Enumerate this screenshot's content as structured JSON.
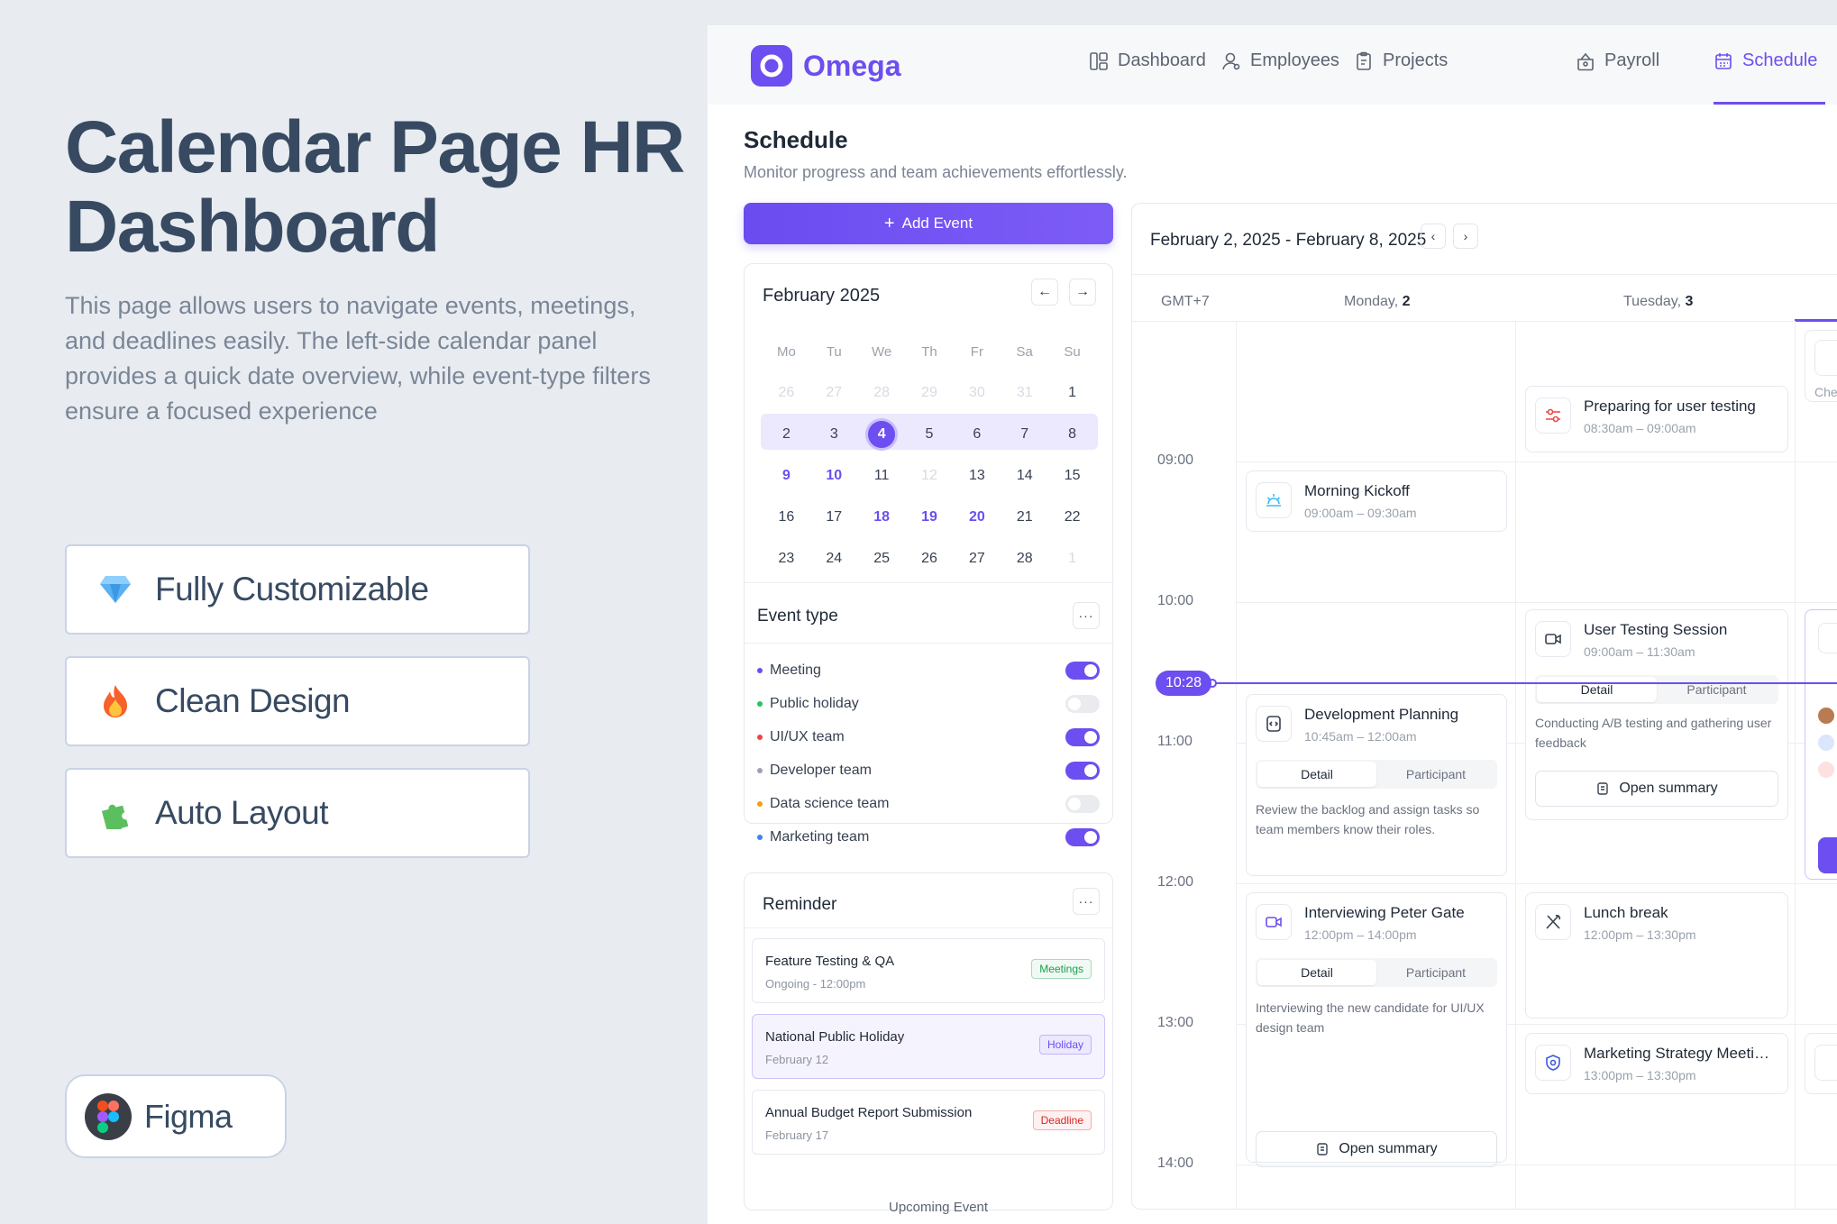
{
  "promo": {
    "title": "Calendar Page HR Dashboard",
    "description": "This page allows users to navigate events, meetings, and deadlines easily. The left-side calendar panel provides a quick date overview, while event-type filters ensure a focused experience",
    "features": [
      {
        "label": "Fully Customizable",
        "icon": "diamond-icon"
      },
      {
        "label": "Clean Design",
        "icon": "fire-icon"
      },
      {
        "label": "Auto Layout",
        "icon": "puzzle-icon"
      }
    ],
    "figma_label": "Figma"
  },
  "app": {
    "brand": "Omega",
    "nav": [
      {
        "label": "Dashboard",
        "icon": "dashboard-icon"
      },
      {
        "label": "Employees",
        "icon": "employees-icon"
      },
      {
        "label": "Projects",
        "icon": "projects-icon"
      },
      {
        "label": "Payroll",
        "icon": "payroll-icon"
      },
      {
        "label": "Schedule",
        "icon": "calendar-icon",
        "active": true
      }
    ],
    "accent": "#6d4ef0"
  },
  "page": {
    "title": "Schedule",
    "subtitle": "Monitor progress and team achievements effortlessly.",
    "add_event": "Add Event"
  },
  "mini_calendar": {
    "month": "February 2025",
    "weekdays": [
      "Mo",
      "Tu",
      "We",
      "Th",
      "Fr",
      "Sa",
      "Su"
    ],
    "weeks": [
      [
        "26",
        "27",
        "28",
        "29",
        "30",
        "31",
        "1"
      ],
      [
        "2",
        "3",
        "4",
        "5",
        "6",
        "7",
        "8"
      ],
      [
        "9",
        "10",
        "11",
        "12",
        "13",
        "14",
        "15"
      ],
      [
        "16",
        "17",
        "18",
        "19",
        "20",
        "21",
        "22"
      ],
      [
        "23",
        "24",
        "25",
        "26",
        "27",
        "28",
        "1"
      ]
    ],
    "today": "4",
    "highlighted": [
      "9",
      "10",
      "18",
      "19",
      "20"
    ]
  },
  "event_types": {
    "title": "Event type",
    "more": "···",
    "items": [
      {
        "label": "Meeting",
        "color": "#6d4ef0",
        "on": true
      },
      {
        "label": "Public holiday",
        "color": "#22c55e",
        "on": false
      },
      {
        "label": "UI/UX team",
        "color": "#ef4444",
        "on": true
      },
      {
        "label": "Developer team",
        "color": "#9ca3af",
        "on": true
      },
      {
        "label": "Data science team",
        "color": "#f59e0b",
        "on": false
      },
      {
        "label": "Marketing team",
        "color": "#3b82f6",
        "on": true
      }
    ]
  },
  "reminder": {
    "title": "Reminder",
    "more": "···",
    "items": [
      {
        "title": "Feature Testing & QA",
        "sub": "Ongoing - 12:00pm",
        "badge": "Meetings",
        "badge_color": "#16a34a"
      },
      {
        "title": "National Public Holiday",
        "sub": "February 12",
        "badge": "Holiday",
        "badge_color": "#6d4ef0"
      },
      {
        "title": "Annual Budget Report Submission",
        "sub": "February 17",
        "badge": "Deadline",
        "badge_color": "#dc2626"
      }
    ],
    "more_link": "Upcoming Event"
  },
  "schedule": {
    "range": "February 2, 2025 - February 8, 2025",
    "timezone": "GMT+7",
    "days": [
      {
        "name": "Monday,",
        "num": "2"
      },
      {
        "name": "Tuesday,",
        "num": "3"
      }
    ],
    "times": [
      "09:00",
      "10:00",
      "11:00",
      "12:00",
      "13:00",
      "14:00"
    ],
    "now": "10:28",
    "events": {
      "preparing": {
        "title": "Preparing for user testing",
        "time": "08:30am – 09:00am"
      },
      "kickoff": {
        "title": "Morning Kickoff",
        "time": "09:00am – 09:30am"
      },
      "user_testing": {
        "title": "User Testing Session",
        "time": "09:00am – 11:30am",
        "tab_detail": "Detail",
        "tab_participant": "Participant",
        "desc": "Conducting A/B testing and gathering user feedback",
        "button": "Open summary"
      },
      "dev_planning": {
        "title": "Development Planning",
        "time": "10:45am – 12:00am",
        "tab_detail": "Detail",
        "tab_participant": "Participant",
        "desc": "Review the backlog and assign tasks so team members know their roles."
      },
      "interview": {
        "title": "Interviewing Peter Gate",
        "time": "12:00pm – 14:00pm",
        "tab_detail": "Detail",
        "tab_participant": "Participant",
        "desc": "Interviewing the new candidate for UI/UX design team",
        "button": "Open summary"
      },
      "lunch": {
        "title": "Lunch break",
        "time": "12:00pm – 13:30pm"
      },
      "marketing": {
        "title": "Marketing Strategy Meeti…",
        "time": "13:00pm – 13:30pm"
      },
      "partial_text": "Che opti"
    }
  }
}
